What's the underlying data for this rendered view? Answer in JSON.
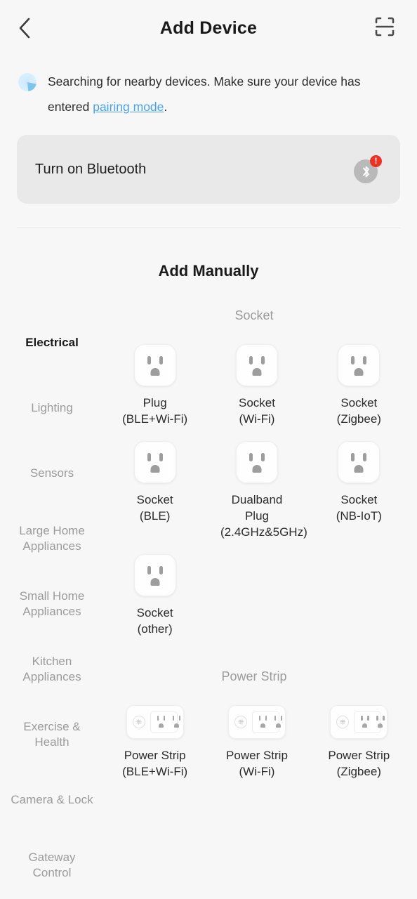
{
  "header": {
    "back_icon": "chevron-left-icon",
    "title": "Add Device",
    "scan_icon": "scan-qr-icon"
  },
  "searching": {
    "icon": "radar-spinner-icon",
    "text_before": "Searching for nearby devices. Make sure your device has entered ",
    "link_text": "pairing mode",
    "text_after": "."
  },
  "bluetooth_card": {
    "label": "Turn on Bluetooth",
    "icon": "bluetooth-icon",
    "badge": "!",
    "badge_color": "#ea3323",
    "card_color": "#e9e9e9"
  },
  "add_manually_title": "Add Manually",
  "sidebar": {
    "items": [
      {
        "label": "Electrical",
        "active": true
      },
      {
        "label": "Lighting",
        "active": false
      },
      {
        "label": "Sensors",
        "active": false
      },
      {
        "label": "Large Home Appliances",
        "active": false
      },
      {
        "label": "Small Home Appliances",
        "active": false
      },
      {
        "label": "Kitchen Appliances",
        "active": false
      },
      {
        "label": "Exercise & Health",
        "active": false
      },
      {
        "label": "Camera & Lock",
        "active": false
      },
      {
        "label": "Gateway Control",
        "active": false
      }
    ]
  },
  "sections": [
    {
      "title": "Socket",
      "items": [
        {
          "icon": "socket-icon",
          "label": "Plug\n(BLE+Wi-Fi)"
        },
        {
          "icon": "socket-icon",
          "label": "Socket\n(Wi-Fi)"
        },
        {
          "icon": "socket-icon",
          "label": "Socket\n(Zigbee)"
        },
        {
          "icon": "socket-icon",
          "label": "Socket\n(BLE)"
        },
        {
          "icon": "socket-icon",
          "label": "Dualband Plug (2.4GHz&5GHz)"
        },
        {
          "icon": "socket-icon",
          "label": "Socket\n(NB-IoT)"
        },
        {
          "icon": "socket-icon",
          "label": "Socket\n(other)"
        }
      ]
    },
    {
      "title": "Power Strip",
      "items": [
        {
          "icon": "power-strip-icon",
          "label": "Power Strip\n(BLE+Wi-Fi)"
        },
        {
          "icon": "power-strip-icon",
          "label": "Power Strip\n(Wi-Fi)"
        },
        {
          "icon": "power-strip-icon",
          "label": "Power Strip\n(Zigbee)"
        }
      ]
    }
  ],
  "colors": {
    "background": "#f7f7f7",
    "link": "#4aa3e8",
    "muted_text": "#9b9b9b",
    "primary_text": "#1a1a1a"
  }
}
